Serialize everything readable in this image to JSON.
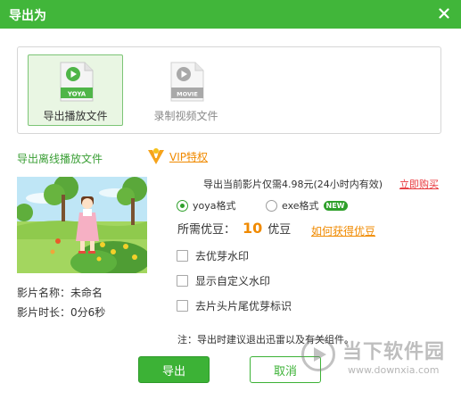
{
  "dialog": {
    "title": "导出为"
  },
  "formats": [
    {
      "label": "导出播放文件",
      "tag": "YOYA",
      "selected": true
    },
    {
      "label": "录制视频文件",
      "tag": "MOVIE",
      "selected": false
    }
  ],
  "offline": {
    "title": "导出离线播放文件",
    "vip_link": "VIP特权"
  },
  "movie": {
    "name": "影片名称：未命名",
    "duration": "影片时长：0分6秒"
  },
  "price": {
    "text": "导出当前影片仅需4.98元(24小时内有效)",
    "buy_link": "立即购买"
  },
  "format_options": [
    {
      "label": "yoya格式",
      "checked": true
    },
    {
      "label": "exe格式",
      "checked": false,
      "badge": "NEW"
    }
  ],
  "beans": {
    "label": "所需优豆：",
    "value": "10",
    "unit": "优豆",
    "link": "如何获得优豆"
  },
  "options": [
    {
      "label": "去优芽水印",
      "checked": false
    },
    {
      "label": "显示自定义水印",
      "checked": false
    },
    {
      "label": "去片头片尾优芽标识",
      "checked": false
    }
  ],
  "note": "注：导出时建议退出迅雷以及有关组件。",
  "buttons": {
    "ok": "导出",
    "cancel": "取消"
  },
  "watermark": {
    "text": "当下软件园",
    "url": "www.downxia.com"
  },
  "colors": {
    "accent": "#41b63a",
    "link_orange": "#f08a00",
    "link_red": "#e8383d"
  }
}
